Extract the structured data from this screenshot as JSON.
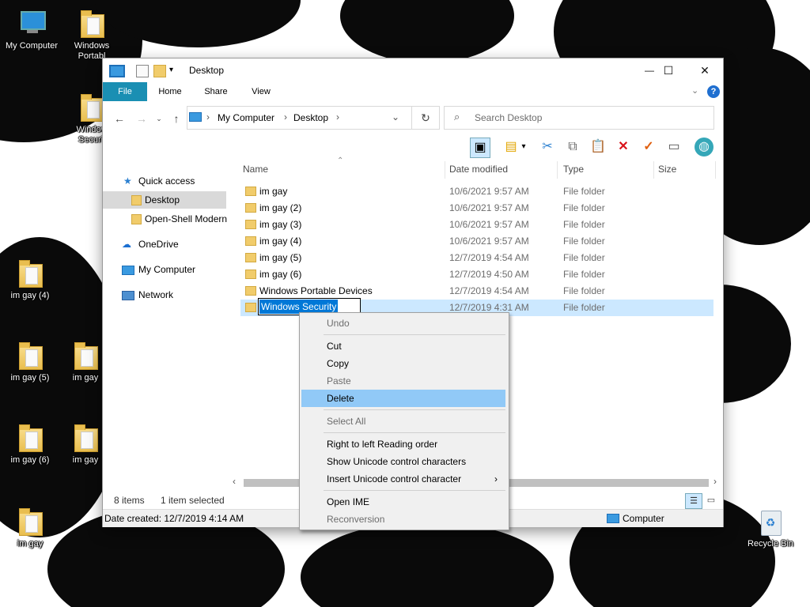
{
  "desktop": {
    "icons": [
      {
        "label": "My Computer",
        "kind": "computer"
      },
      {
        "label": "Windows Portabl",
        "kind": "folder"
      },
      {
        "label": "Window Securit",
        "kind": "folder"
      },
      {
        "label": "im gay (4)",
        "kind": "folder"
      },
      {
        "label": "im gay (5)",
        "kind": "folder"
      },
      {
        "label": "im gay",
        "kind": "folder"
      },
      {
        "label": "im gay (6)",
        "kind": "folder"
      },
      {
        "label": "im gay",
        "kind": "folder"
      },
      {
        "label": "im gay",
        "kind": "folder"
      },
      {
        "label": "Recycle Bin",
        "kind": "recycle-bin"
      }
    ]
  },
  "window": {
    "title": "Desktop",
    "controls": {
      "minimize": "—",
      "maximize": "☐",
      "close": "✕"
    },
    "ribbon_tabs": [
      "File",
      "Home",
      "Share",
      "View"
    ],
    "help": "?",
    "breadcrumb": [
      "My Computer",
      "Desktop"
    ],
    "search_placeholder": "Search Desktop",
    "columns": [
      "Name",
      "Date modified",
      "Type",
      "Size"
    ],
    "nav": {
      "quick_access": "Quick access",
      "desktop": "Desktop",
      "open_shell": "Open-Shell Modern",
      "onedrive": "OneDrive",
      "my_computer": "My Computer",
      "network": "Network"
    },
    "files": [
      {
        "name": "im gay",
        "date": "10/6/2021 9:57 AM",
        "type": "File folder"
      },
      {
        "name": "im gay (2)",
        "date": "10/6/2021 9:57 AM",
        "type": "File folder"
      },
      {
        "name": "im gay (3)",
        "date": "10/6/2021 9:57 AM",
        "type": "File folder"
      },
      {
        "name": "im gay (4)",
        "date": "10/6/2021 9:57 AM",
        "type": "File folder"
      },
      {
        "name": "im gay (5)",
        "date": "12/7/2019 4:54 AM",
        "type": "File folder"
      },
      {
        "name": "im gay (6)",
        "date": "12/7/2019 4:50 AM",
        "type": "File folder"
      },
      {
        "name": "Windows Portable Devices",
        "date": "12/7/2019 4:54 AM",
        "type": "File folder"
      },
      {
        "name": "Windows Security",
        "date": "12/7/2019 4:31 AM",
        "type": "File folder"
      }
    ],
    "status": {
      "items": "8 items",
      "selected": "1 item selected"
    },
    "details": {
      "created": "Date created: 12/7/2019 4:14 AM",
      "location": "Computer"
    }
  },
  "context_menu": {
    "items": [
      {
        "label": "Undo",
        "disabled": true
      },
      {
        "label": "Cut",
        "disabled": false
      },
      {
        "label": "Copy",
        "disabled": false
      },
      {
        "label": "Paste",
        "disabled": true
      },
      {
        "label": "Delete",
        "disabled": false,
        "highlighted": true
      },
      {
        "label": "Select All",
        "disabled": true
      },
      {
        "label": "Right to left Reading order",
        "disabled": false
      },
      {
        "label": "Show Unicode control characters",
        "disabled": false
      },
      {
        "label": "Insert Unicode control character",
        "disabled": false,
        "submenu": true
      },
      {
        "label": "Open IME",
        "disabled": false
      },
      {
        "label": "Reconversion",
        "disabled": true
      }
    ]
  },
  "colors": {
    "accent": "#1a8fb3",
    "selection": "#cce8ff",
    "menu_highlight": "#91c9f7",
    "red_x": "#d9131a",
    "check": "#e06010"
  }
}
